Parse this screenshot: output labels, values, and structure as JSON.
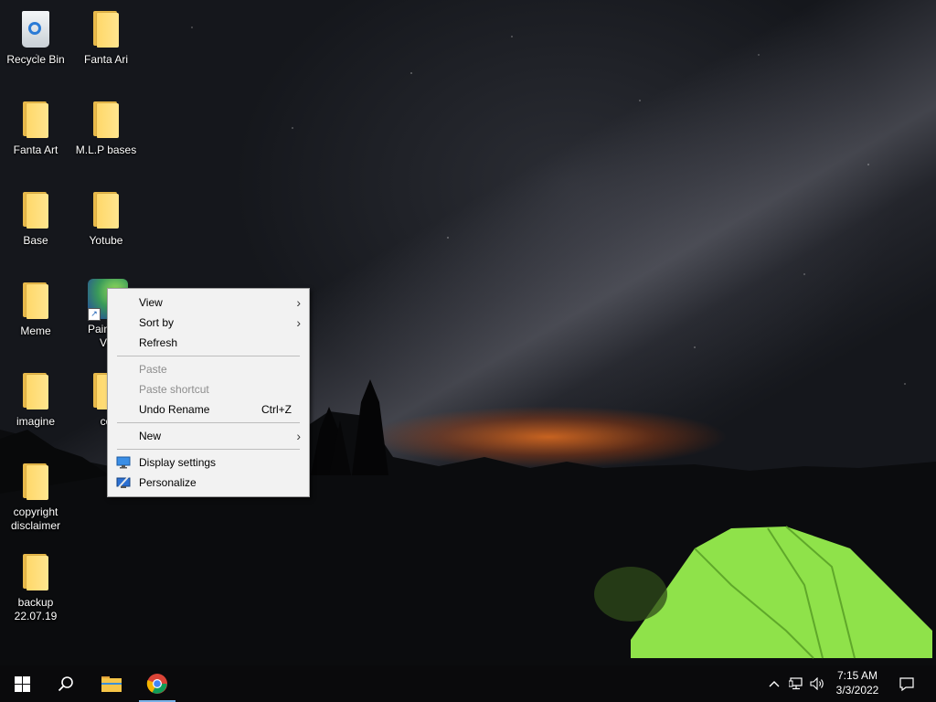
{
  "desktop": {
    "icons": [
      {
        "label": "Recycle Bin",
        "icon": "recycle-bin-icon"
      },
      {
        "label": "Fanta Ari",
        "icon": "folder-icon"
      },
      {
        "label": "Fanta Art",
        "icon": "folder-icon"
      },
      {
        "label": "M.L.P bases",
        "icon": "folder-icon"
      },
      {
        "label": "Base",
        "icon": "folder-icon"
      },
      {
        "label": "Yotube",
        "icon": "folder-icon"
      },
      {
        "label": "Meme",
        "icon": "folder-icon"
      },
      {
        "label_line1": "PaintTo",
        "label_line2": "Ve",
        "icon": "painttool-app-icon"
      },
      {
        "label": "imagine",
        "icon": "folder-icon"
      },
      {
        "label": "co",
        "icon": "folder-icon"
      },
      {
        "label_line1": "copyright",
        "label_line2": "disclaimer",
        "icon": "folder-icon"
      },
      {
        "label_line1": "backup",
        "label_line2": "22.07.19",
        "icon": "folder-icon"
      }
    ]
  },
  "context_menu": {
    "items": [
      {
        "label": "View",
        "submenu": true
      },
      {
        "label": "Sort by",
        "submenu": true
      },
      {
        "label": "Refresh"
      },
      {
        "label": "Paste",
        "disabled": true
      },
      {
        "label": "Paste shortcut",
        "disabled": true
      },
      {
        "label": "Undo Rename",
        "shortcut": "Ctrl+Z"
      },
      {
        "label": "New",
        "submenu": true
      },
      {
        "label": "Display settings",
        "icon": "display-settings-icon"
      },
      {
        "label": "Personalize",
        "icon": "personalize-icon"
      }
    ]
  },
  "taskbar": {
    "start": "windows-start-icon",
    "search": "search-icon",
    "pinned": [
      "file-explorer-icon",
      "chrome-icon"
    ],
    "tray": [
      "chevron-up-icon",
      "network-icon",
      "volume-icon"
    ],
    "clock": {
      "time": "7:15 AM",
      "date": "3/3/2022"
    },
    "notifications": "action-center-icon"
  },
  "colors": {
    "menu_bg": "#f2f2f2",
    "taskbar_bg": "#0a0a0c",
    "active_indicator": "#7ab2e8",
    "folder": "#ffd86a"
  }
}
